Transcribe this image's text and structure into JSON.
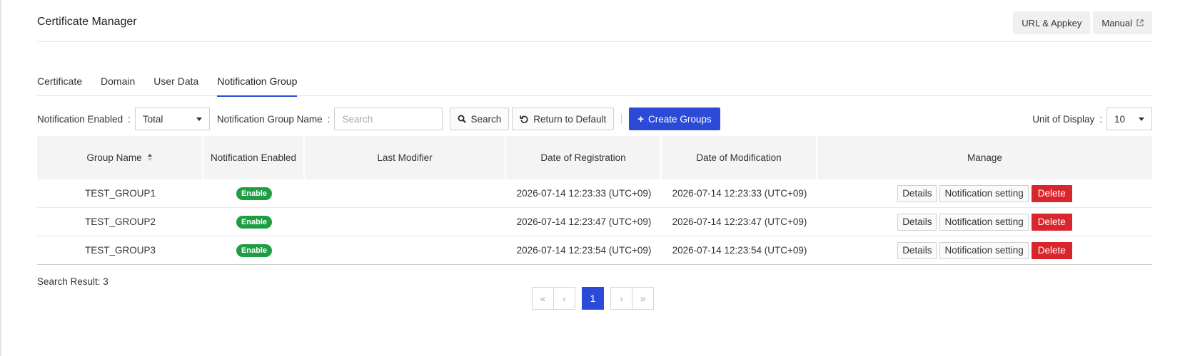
{
  "header": {
    "title": "Certificate Manager",
    "url_appkey_label": "URL & Appkey",
    "manual_label": "Manual"
  },
  "tabs": [
    {
      "label": "Certificate",
      "active": false
    },
    {
      "label": "Domain",
      "active": false
    },
    {
      "label": "User Data",
      "active": false
    },
    {
      "label": "Notification Group",
      "active": true
    }
  ],
  "toolbar": {
    "notification_enabled_label": "Notification Enabled",
    "notification_enabled_value": "Total",
    "group_name_label": "Notification Group Name",
    "search_placeholder": "Search",
    "search_button": "Search",
    "return_default_button": "Return to Default",
    "create_groups_button": "Create Groups",
    "unit_display_label": "Unit of Display",
    "unit_display_value": "10"
  },
  "colon": ":",
  "table": {
    "columns": [
      "Group Name",
      "Notification Enabled",
      "Last Modifier",
      "Date of Registration",
      "Date of Modification",
      "Manage"
    ],
    "rows": [
      {
        "group_name": "TEST_GROUP1",
        "enabled": "Enable",
        "last_modifier": "",
        "registered": "2026-07-14 12:23:33 (UTC+09)",
        "modified": "2026-07-14 12:23:33 (UTC+09)"
      },
      {
        "group_name": "TEST_GROUP2",
        "enabled": "Enable",
        "last_modifier": "",
        "registered": "2026-07-14 12:23:47 (UTC+09)",
        "modified": "2026-07-14 12:23:47 (UTC+09)"
      },
      {
        "group_name": "TEST_GROUP3",
        "enabled": "Enable",
        "last_modifier": "",
        "registered": "2026-07-14 12:23:54 (UTC+09)",
        "modified": "2026-07-14 12:23:54 (UTC+09)"
      }
    ],
    "actions": {
      "details": "Details",
      "notification_setting": "Notification setting",
      "delete": "Delete"
    }
  },
  "search_result": "Search Result: 3",
  "pagination": {
    "first": "«",
    "prev": "‹",
    "current": "1",
    "next": "›",
    "last": "»"
  },
  "colors": {
    "primary": "#2b4ad8",
    "success": "#1e9e43",
    "danger": "#d9262c"
  }
}
